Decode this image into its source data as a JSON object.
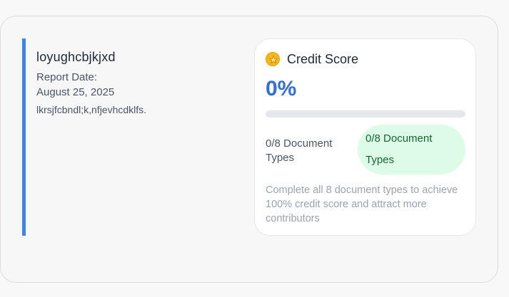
{
  "report": {
    "title": "loyughcbjkjxd",
    "date_label": "Report Date:",
    "date_value": "August 25, 2025",
    "description": "lkrsjfcbndl;k,nfjevhcdklfs."
  },
  "credit": {
    "icon": "star-coin-icon",
    "title": "Credit Score",
    "percent_label": "0%",
    "progress": 0,
    "doc_types_text": "0/8 Document Types",
    "doc_types_badge": "0/8 Document Types",
    "hint": "Complete all 8 document types to achieve 100% credit score and attract more contributors"
  },
  "colors": {
    "accent": "#3b82f6",
    "percent": "#2f6fdf",
    "badge_bg": "#dcfce7",
    "badge_text": "#166534",
    "icon_gold": "#f5b915"
  }
}
